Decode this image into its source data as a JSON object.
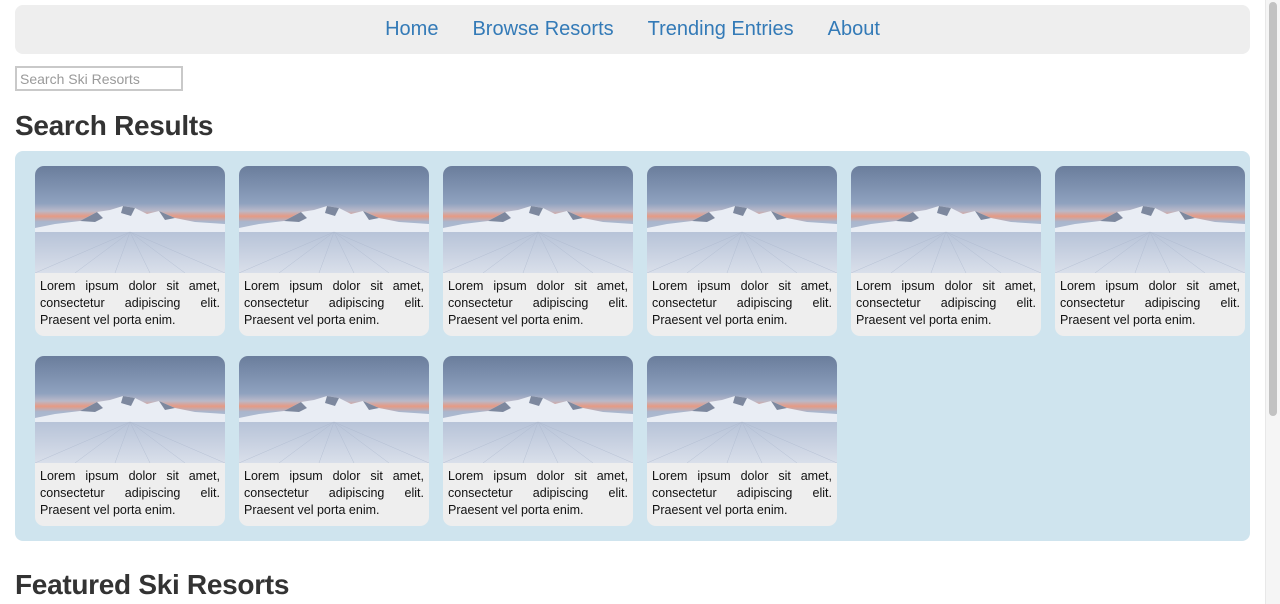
{
  "nav": {
    "items": [
      {
        "label": "Home"
      },
      {
        "label": "Browse Resorts"
      },
      {
        "label": "Trending Entries"
      },
      {
        "label": "About"
      }
    ],
    "link_color": "#337ab7"
  },
  "search": {
    "placeholder": "Search Ski Resorts",
    "value": ""
  },
  "results": {
    "title": "Search Results",
    "panel_color": "#cfe4ee",
    "cards": [
      {
        "text": "Lorem ipsum dolor sit amet, consectetur adipiscing elit. Praesent vel porta enim."
      },
      {
        "text": "Lorem ipsum dolor sit amet, consectetur adipiscing elit. Praesent vel porta enim."
      },
      {
        "text": "Lorem ipsum dolor sit amet, consectetur adipiscing elit. Praesent vel porta enim."
      },
      {
        "text": "Lorem ipsum dolor sit amet, consectetur adipiscing elit. Praesent vel porta enim."
      },
      {
        "text": "Lorem ipsum dolor sit amet, consectetur adipiscing elit. Praesent vel porta enim."
      },
      {
        "text": "Lorem ipsum dolor sit amet, consectetur adipiscing elit. Praesent vel porta enim."
      },
      {
        "text": "Lorem ipsum dolor sit amet, consectetur adipiscing elit. Praesent vel porta enim."
      },
      {
        "text": "Lorem ipsum dolor sit amet, consectetur adipiscing elit. Praesent vel porta enim."
      },
      {
        "text": "Lorem ipsum dolor sit amet, consectetur adipiscing elit. Praesent vel porta enim."
      },
      {
        "text": "Lorem ipsum dolor sit amet, consectetur adipiscing elit. Praesent vel porta enim."
      }
    ]
  },
  "featured": {
    "title": "Featured Ski Resorts"
  }
}
